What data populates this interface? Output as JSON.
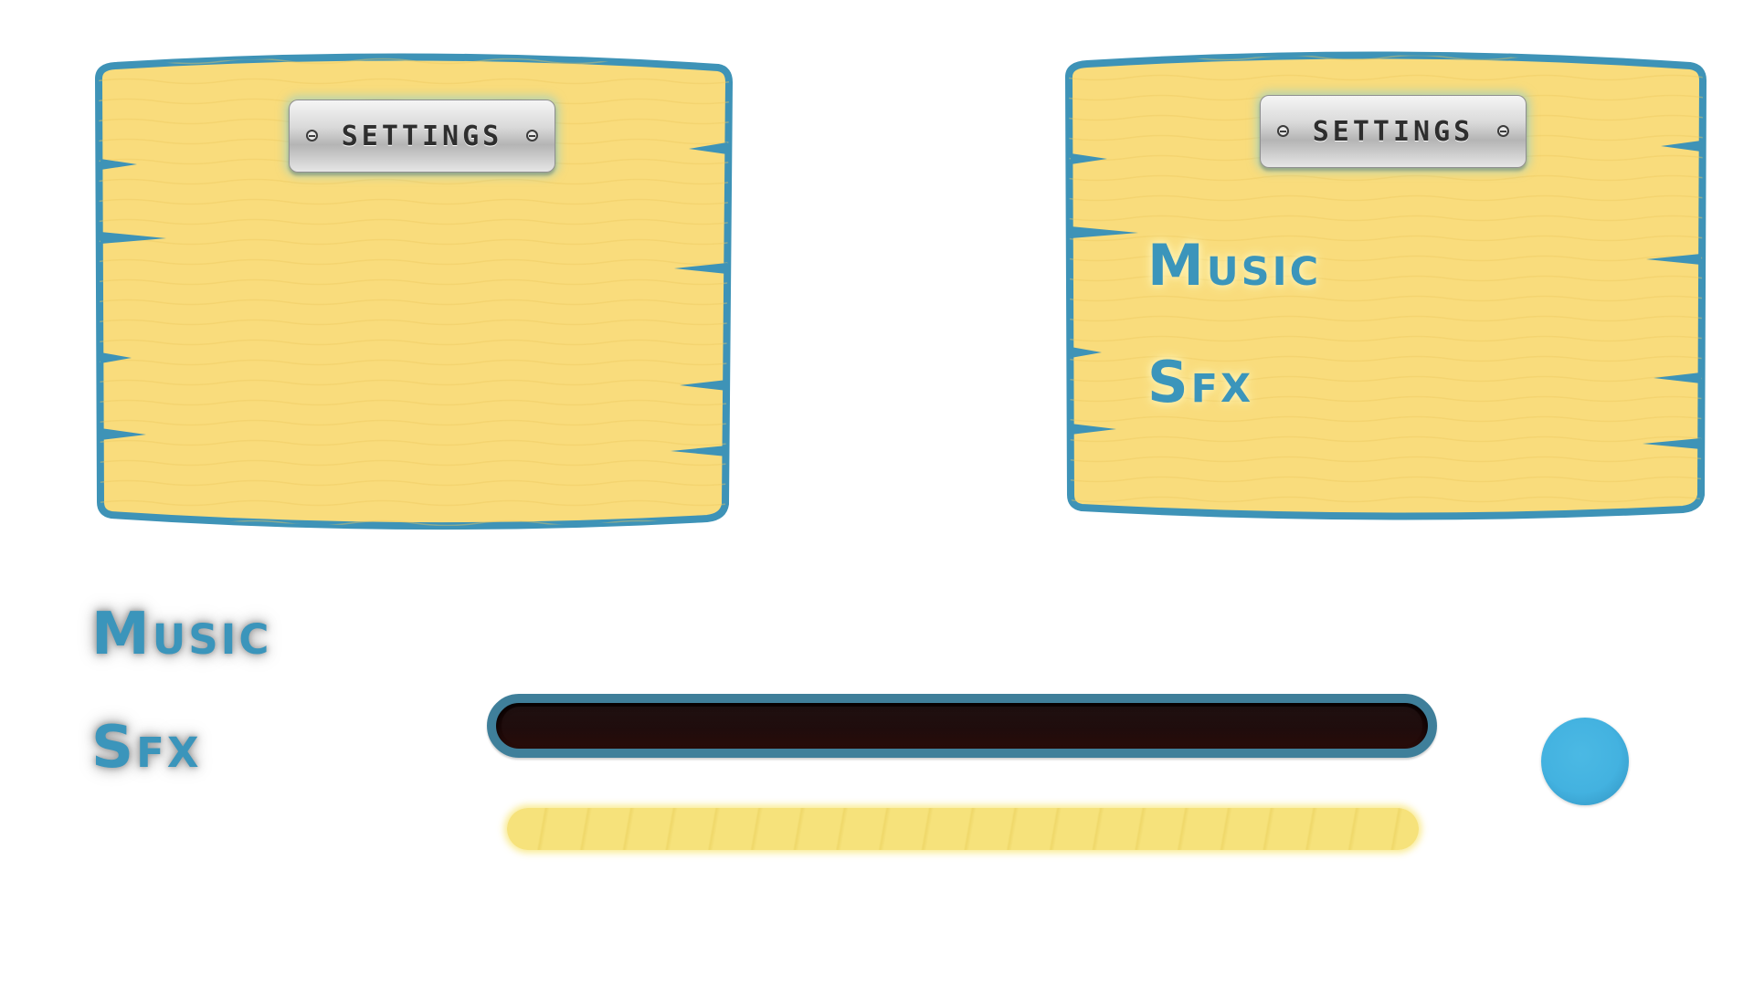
{
  "panels": [
    {
      "title": "SETTINGS"
    },
    {
      "title": "SETTINGS",
      "music_label": "Music",
      "sfx_label": "Sfx"
    }
  ],
  "standalone": {
    "music_label": "Music",
    "sfx_label": "Sfx"
  },
  "slider": {
    "fill_fraction": 0.96
  },
  "colors": {
    "board_fill": "#f9dc7c",
    "board_border": "#3e93b7",
    "label_blue": "#3b95bb",
    "knob": "#43b2e0",
    "track_border": "#3f7f9a",
    "track_fill": "#140404",
    "fill_bar": "#f6e27b"
  }
}
